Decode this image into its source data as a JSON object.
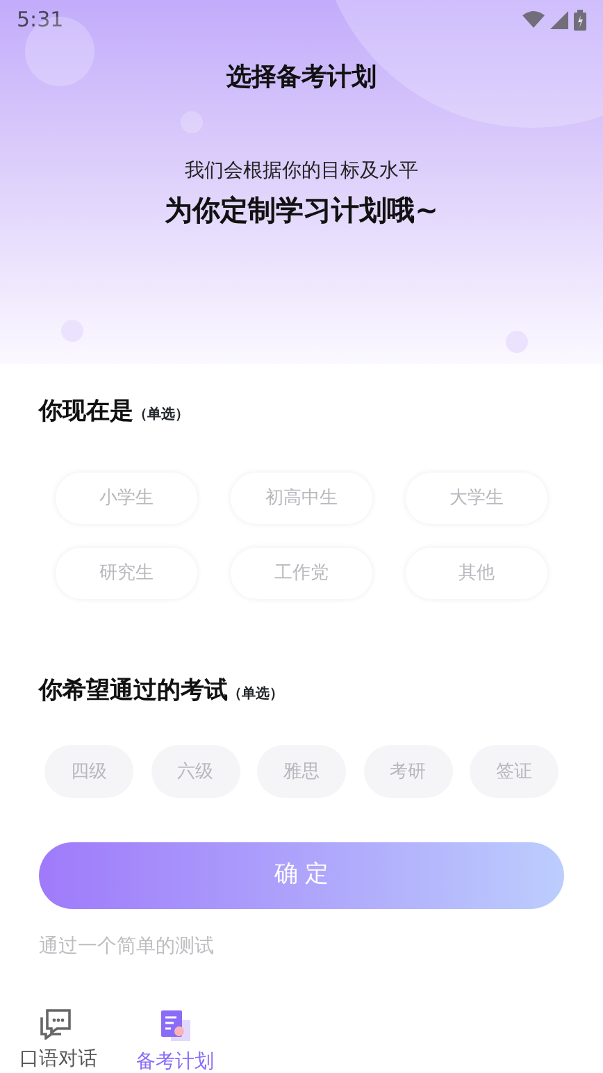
{
  "status_bar": {
    "time": "5:31"
  },
  "title": "选择备考计划",
  "intro": {
    "line_1": "我们会根据你的目标及水平",
    "line_2": "为你定制学习计划哦~"
  },
  "identity": {
    "heading": "你现在是",
    "note": "（单选）",
    "options": [
      {
        "label": "小学生",
        "selected": false
      },
      {
        "label": "初高中生",
        "selected": false
      },
      {
        "label": "大学生",
        "selected": false
      },
      {
        "label": "研究生",
        "selected": false
      },
      {
        "label": "工作党",
        "selected": false
      },
      {
        "label": "其他",
        "selected": false
      }
    ]
  },
  "exam": {
    "heading": "你希望通过的考试",
    "note": "（单选）",
    "options": [
      {
        "label": "四级",
        "selected": false
      },
      {
        "label": "六级",
        "selected": false
      },
      {
        "label": "雅思",
        "selected": false
      },
      {
        "label": "考研",
        "selected": false
      },
      {
        "label": "签证",
        "selected": false
      }
    ]
  },
  "confirm_button": "确 定",
  "hint": "通过一个简单的测试",
  "bottom_nav": [
    {
      "label": "口语对话",
      "kind": "chat",
      "selected": false
    },
    {
      "label": "备考计划",
      "kind": "plan",
      "selected": true
    }
  ]
}
